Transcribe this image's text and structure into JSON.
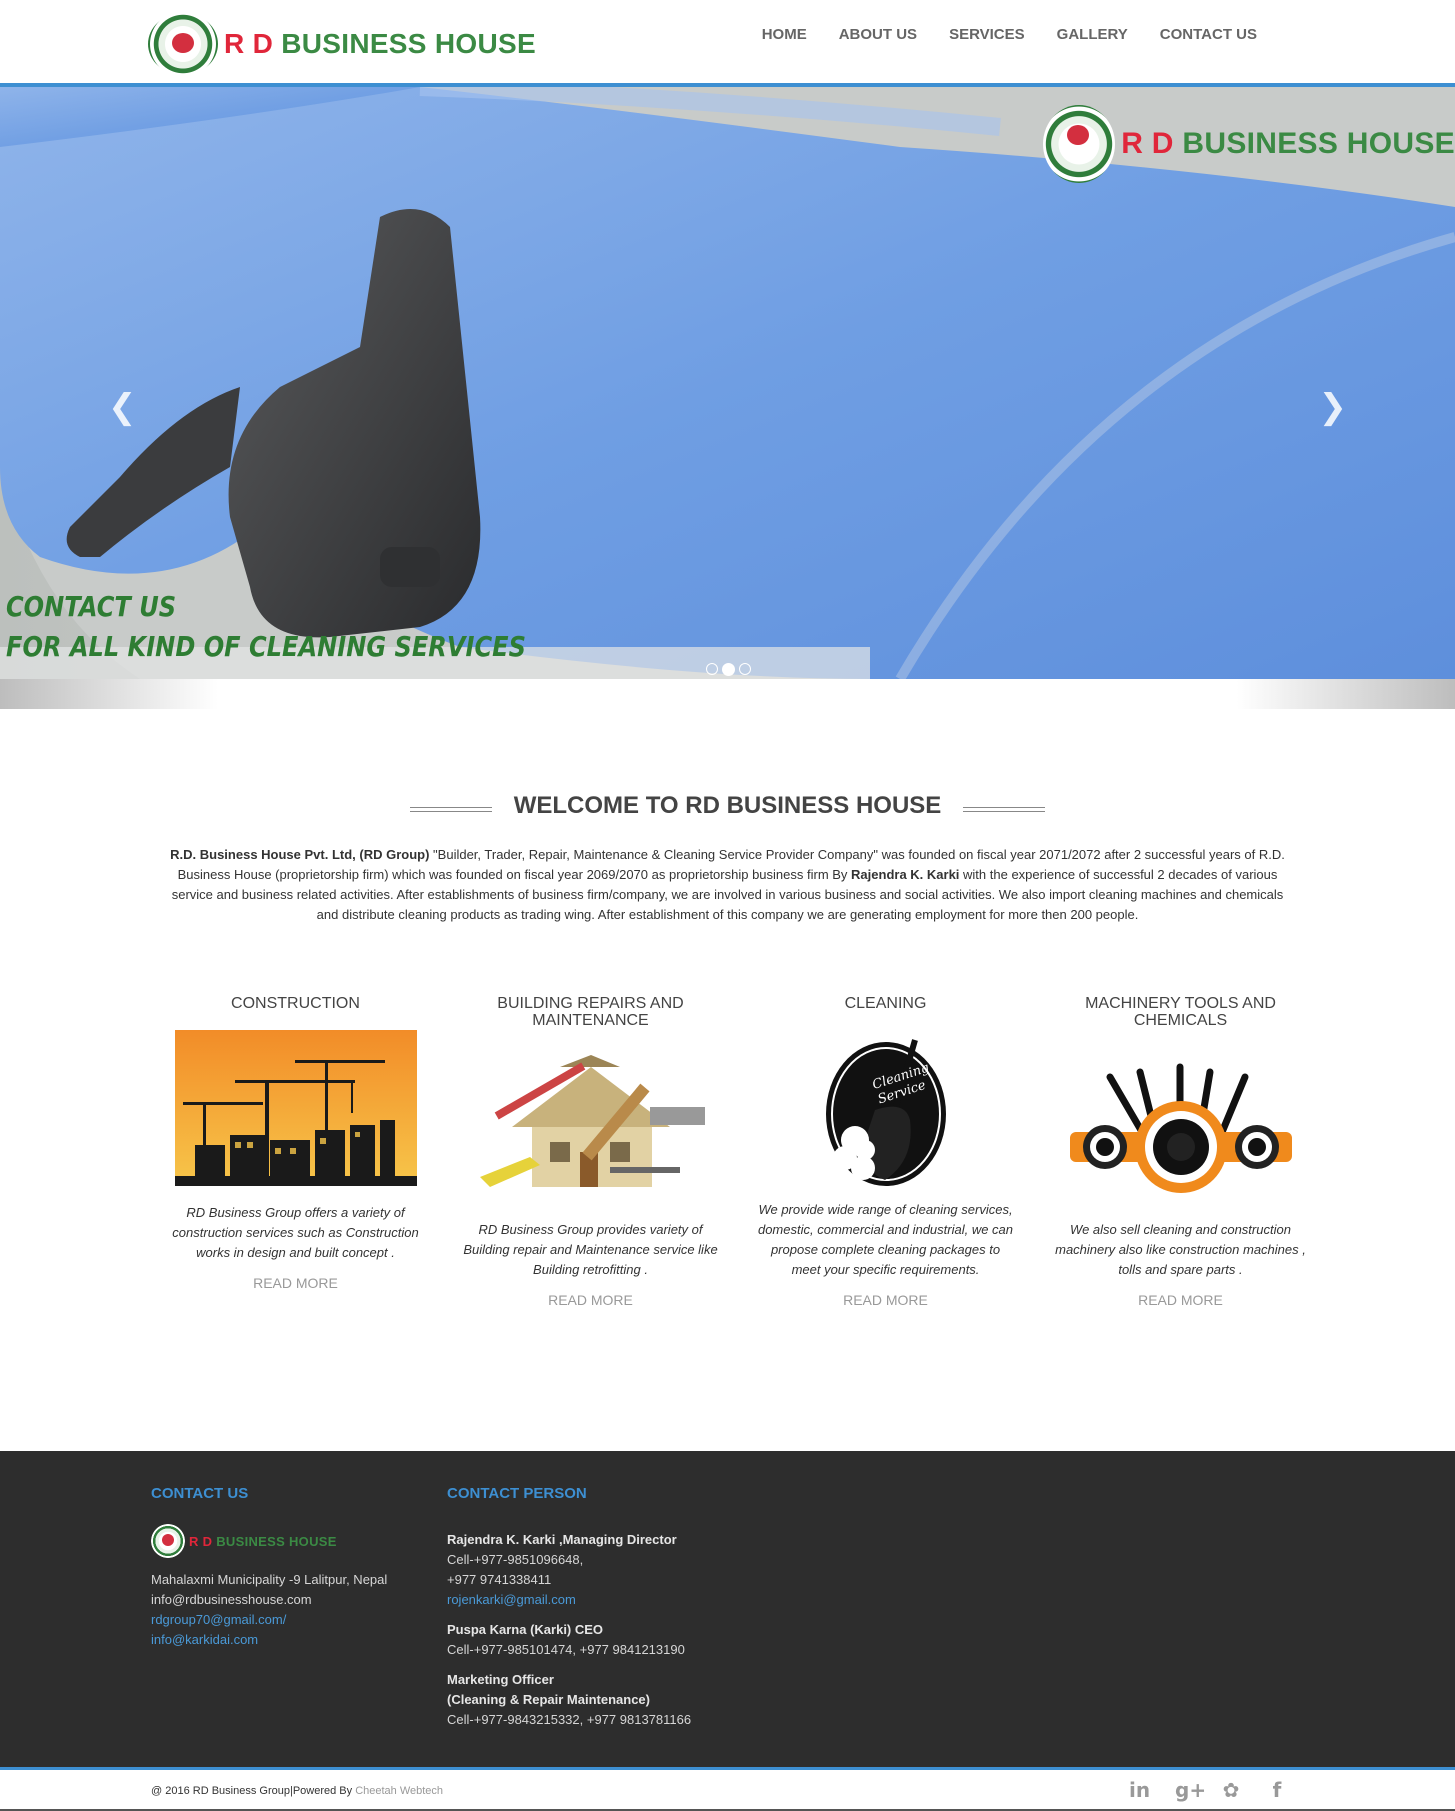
{
  "header": {
    "logo_rd": "R D",
    "logo_business_house": "BUSINESS HOUSE",
    "nav": [
      "HOME",
      "ABOUT US",
      "SERVICES",
      "GALLERY",
      "CONTACT US"
    ]
  },
  "slider": {
    "logo_rd": "R D",
    "logo_business_house": "BUSINESS HOUSE",
    "caption_line1": "CONTACT US",
    "caption_line2": "FOR ALL KIND OF CLEANING SERVICES",
    "prev_icon": "chevron-left-icon",
    "next_icon": "chevron-right-icon",
    "slide_count": 3,
    "active_slide": 2
  },
  "welcome": {
    "title": "WELCOME TO RD BUSINESS HOUSE",
    "intro_bold1": "R.D. Business House Pvt. Ltd, (RD Group)",
    "intro_part1": " \"Builder, Trader, Repair, Maintenance & Cleaning Service Provider Company\" was founded on fiscal year 2071/2072 after 2 successful years of R.D. Business House (proprietorship firm) which was founded on fiscal year 2069/2070 as proprietorship business firm By ",
    "intro_bold2": "Rajendra K. Karki",
    "intro_part2": " with the experience of successful 2 decades of various service and business related activities. After establishments of business firm/company, we are involved in various business and social activities. We also import cleaning  machines and chemicals and distribute cleaning products as trading wing. After establishment of this company we are generating employment for more then 200 people."
  },
  "services": [
    {
      "title": "CONSTRUCTION",
      "desc": "RD Business Group offers a variety of construction services such as Construction works in design and built concept .",
      "more": "READ MORE"
    },
    {
      "title": "BUILDING REPAIRS AND MAINTENANCE",
      "desc": "RD Business Group provides variety of Building repair and Maintenance service like Building retrofitting .",
      "more": "READ MORE"
    },
    {
      "title": "CLEANING",
      "desc": "We provide wide range of cleaning services, domestic, commercial and industrial, we can propose complete cleaning packages to meet your specific requirements.",
      "more": "READ MORE",
      "image_text1": "Cleaning",
      "image_text2": "Service"
    },
    {
      "title": "MACHINERY TOOLS AND CHEMICALS",
      "desc": "We also sell cleaning and construction machinery also like construction machines , tolls and spare parts .",
      "more": "READ MORE"
    }
  ],
  "footer": {
    "contact_heading": "CONTACT US",
    "logo_rd": "R D",
    "logo_business_house": "BUSINESS HOUSE",
    "address": "Mahalaxmi Municipality -9 Lalitpur, Nepal",
    "email_plain": "info@rdbusinesshouse.com",
    "email_link1": "rdgroup70@gmail.com/",
    "email_link2": "info@karkidai.com",
    "person_heading": "CONTACT PERSON",
    "person1_name": "Rajendra K. Karki ,Managing Director",
    "person1_cell": "Cell-+977-9851096648,",
    "person1_cell2": "+977 9741338411",
    "person1_email": "rojenkarki@gmail.com",
    "person2_name": "Puspa Karna (Karki) CEO",
    "person2_cell": "Cell-+977-985101474, +977 9841213190",
    "person3_name": "Marketing Officer",
    "person3_role": "(Cleaning & Repair Maintenance)",
    "person3_cell": "Cell-+977-9843215332, +977 9813781166"
  },
  "bottom": {
    "copyright": "@ 2016 RD Business Group|Powered By ",
    "powered_by": "Cheetah Webtech",
    "socials": [
      "linkedin-icon",
      "google-plus-icon",
      "twitter-icon",
      "facebook-icon"
    ]
  },
  "colors": {
    "accent_blue": "#3d8fd2",
    "brand_red": "#e0263a",
    "brand_green": "#3b8a44",
    "footer_bg": "#2d2d2d"
  }
}
